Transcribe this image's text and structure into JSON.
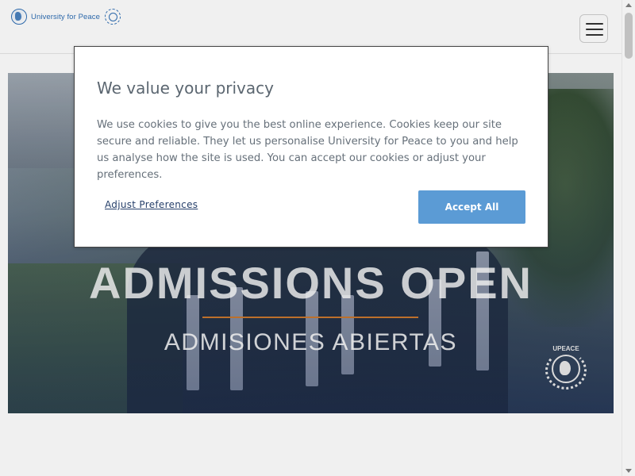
{
  "header": {
    "logo_text": "University for Peace",
    "menu_icon": "hamburger-menu-icon"
  },
  "hero": {
    "title": "ADMISSIONS OPEN",
    "subtitle": "ADMISIONES ABIERTAS",
    "seal_label": "UPEACE",
    "accent_color": "#c9772e"
  },
  "cookie_modal": {
    "title": "We value your privacy",
    "body": "We use cookies to give you the best online experience. Cookies keep our site secure and reliable. They let us personalise University for Peace to you and help us analyse how the site is used. You can accept our cookies or adjust your preferences.",
    "adjust_label": "Adjust Preferences",
    "accept_label": "Accept All",
    "accept_color": "#5b9bd5"
  },
  "colors": {
    "brand_blue": "#2f6fb5",
    "link_color": "#27406b"
  }
}
